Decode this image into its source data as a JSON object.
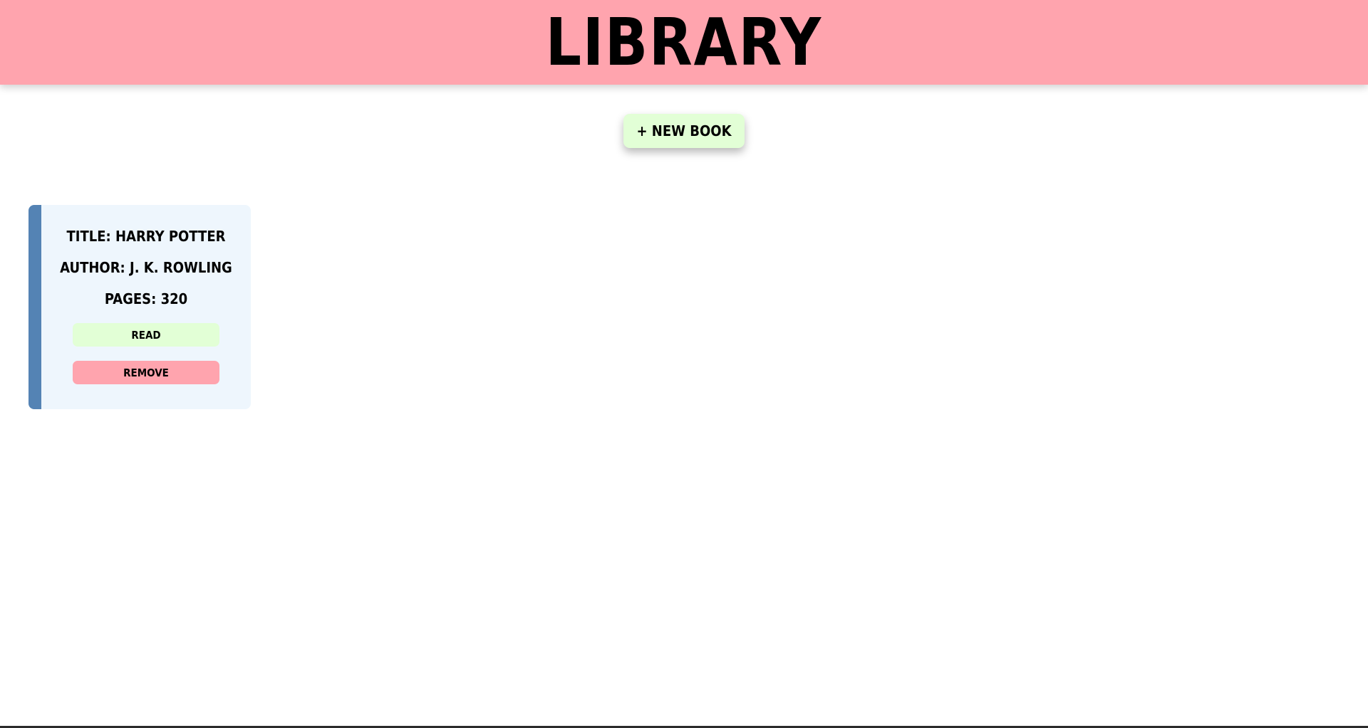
{
  "header": {
    "title": "LIBRARY",
    "background_color": "#ffa4ae"
  },
  "toolbar": {
    "new_book_label": "+ NEW BOOK",
    "new_book_color": "#e2ffd6"
  },
  "books": [
    {
      "title_line": "TITLE: HARRY POTTER",
      "author_line": "AUTHOR: J. K. ROWLING",
      "pages_line": "PAGES: 320",
      "read_label": "READ",
      "remove_label": "REMOVE",
      "accent_color": "#5483b4",
      "card_color": "#eef6fd"
    }
  ]
}
